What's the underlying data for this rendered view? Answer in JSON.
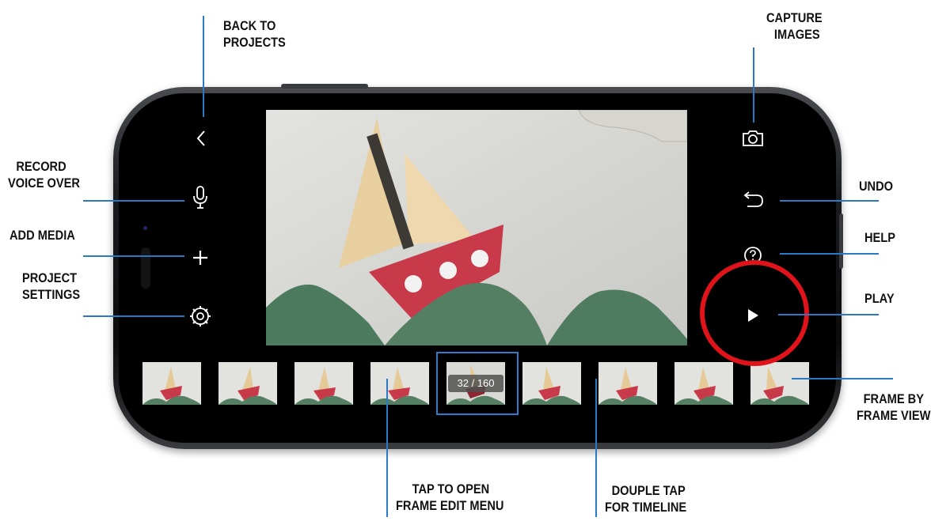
{
  "frame_counter": "32 / 160",
  "accent_color": "#2b7bd1",
  "highlight_color": "#e0131a",
  "controls": {
    "back": "chevron-left-icon",
    "record": "microphone-icon",
    "add_media": "plus-icon",
    "settings": "gear-icon",
    "capture": "camera-icon",
    "undo": "undo-icon",
    "help": "help-icon",
    "play": "play-icon"
  },
  "labels": {
    "back": [
      "BACK TO",
      "PROJECTS"
    ],
    "capture": [
      "CAPTURE",
      "IMAGES"
    ],
    "record": [
      "RECORD",
      "VOICE OVER"
    ],
    "undo": "UNDO",
    "add_media": "ADD MEDIA",
    "help": "HELP",
    "project_settings": [
      "PROJECT",
      "SETTINGS"
    ],
    "play": "PLAY",
    "frame_by_frame": [
      "FRAME BY",
      "FRAME VIEW"
    ],
    "tap_open": [
      "TAP TO OPEN",
      "FRAME EDIT MENU"
    ],
    "double_tap": [
      "DOUPLE TAP",
      "FOR TIMELINE"
    ]
  }
}
